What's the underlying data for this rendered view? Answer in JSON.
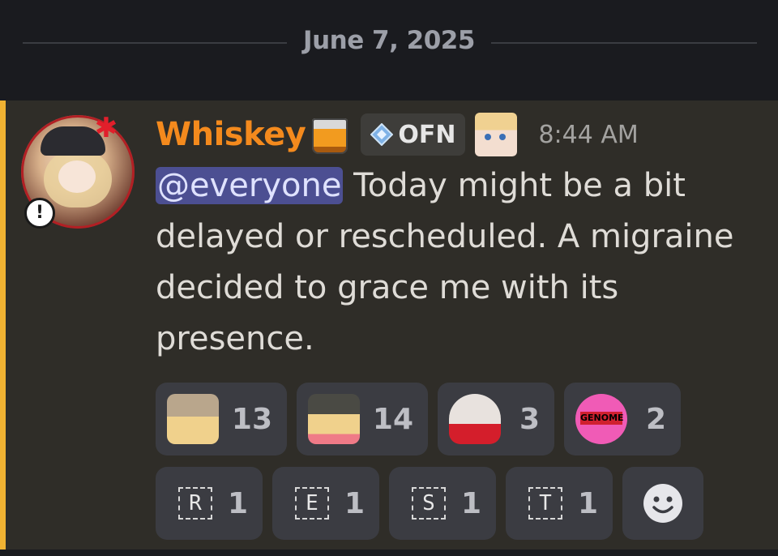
{
  "divider": {
    "date": "June 7, 2025"
  },
  "message": {
    "author": "Whiskey",
    "author_color": "#f48a1d",
    "tag": {
      "label": "OFN",
      "icon": "diamond-icon"
    },
    "timestamp": "8:44 AM",
    "mention": "@everyone",
    "text": " Today might be a bit delayed or rescheduled. A migraine decided to grace me with its presence.",
    "accent_bar_color": "#f0b232"
  },
  "reactions": {
    "row1": [
      {
        "emoji": "hand-on-head-emoji",
        "count": "13"
      },
      {
        "emoji": "heart-hug-emoji",
        "count": "14"
      },
      {
        "emoji": "heart-girl-emoji",
        "count": "3"
      },
      {
        "emoji": "pink-heart-emoji",
        "count": "2",
        "label": "GENOME"
      }
    ],
    "row2": [
      {
        "emoji": "letter-r-emoji",
        "letter": "R",
        "count": "1"
      },
      {
        "emoji": "letter-e-emoji",
        "letter": "E",
        "count": "1"
      },
      {
        "emoji": "letter-s-emoji",
        "letter": "S",
        "count": "1"
      },
      {
        "emoji": "letter-t-emoji",
        "letter": "T",
        "count": "1"
      }
    ],
    "add_reaction_icon": "smiley-icon"
  }
}
